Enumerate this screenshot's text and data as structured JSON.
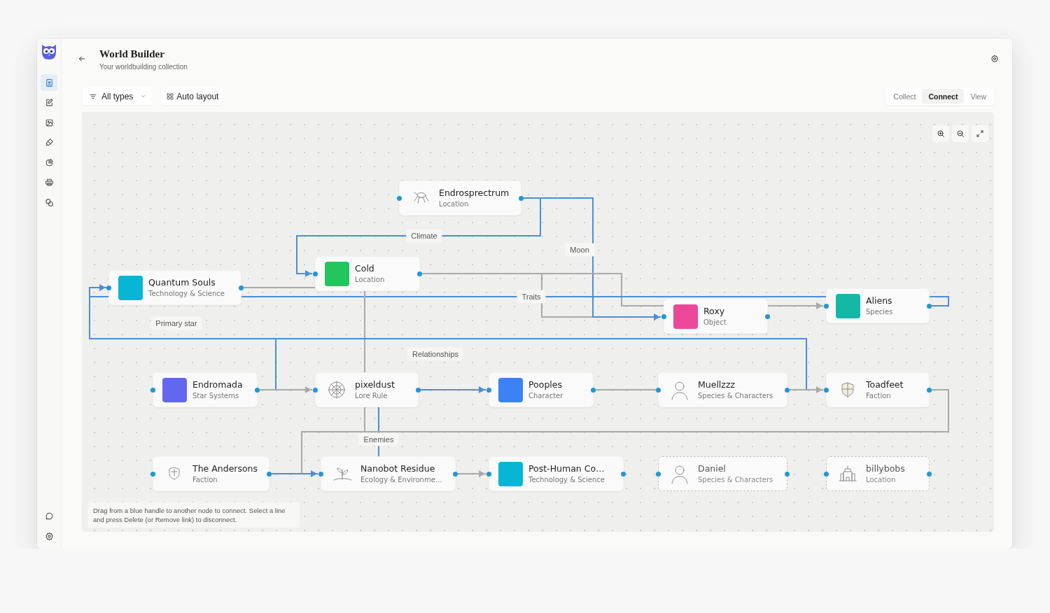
{
  "sidebar": {
    "items": [
      {
        "selected": true
      },
      {
        "selected": false
      },
      {
        "selected": false
      },
      {
        "selected": false
      },
      {
        "selected": false
      },
      {
        "selected": false
      },
      {
        "selected": false
      }
    ]
  },
  "header": {
    "title": "World Builder",
    "subtitle": "Your worldbuilding collection"
  },
  "toolbar": {
    "filter": "All types",
    "layout_button": "Auto layout"
  },
  "modes": [
    {
      "label": "Collect",
      "selected": false
    },
    {
      "label": "Connect",
      "selected": true
    },
    {
      "label": "View",
      "selected": false
    }
  ],
  "canvas": {
    "nodes": [
      {
        "title": "Endrosprectrum",
        "type": "Location",
        "kind": "image",
        "unlinked": false
      },
      {
        "title": "Cold",
        "type": "Location",
        "kind": "swatch",
        "color": "#22c55e",
        "unlinked": false
      },
      {
        "title": "Quantum Souls",
        "type": "Technology & Science",
        "kind": "swatch",
        "color": "#06b6d4",
        "unlinked": false
      },
      {
        "title": "Aliens",
        "type": "Species",
        "kind": "swatch",
        "color": "#14b8a6",
        "unlinked": false
      },
      {
        "title": "Roxy",
        "type": "Object",
        "kind": "swatch",
        "color": "#ec4899",
        "unlinked": false
      },
      {
        "title": "Endromada",
        "type": "Star Systems",
        "kind": "swatch",
        "color": "#6366f1",
        "unlinked": false
      },
      {
        "title": "pixeldust",
        "type": "Lore Rule",
        "kind": "image",
        "unlinked": false
      },
      {
        "title": "Pooples",
        "type": "Character",
        "kind": "swatch",
        "color": "#3b82f6",
        "unlinked": false
      },
      {
        "title": "Muellzzz",
        "type": "Species & Characters",
        "kind": "image",
        "unlinked": false
      },
      {
        "title": "Toadfeet",
        "type": "Faction",
        "kind": "image",
        "unlinked": false
      },
      {
        "title": "The Andersons",
        "type": "Faction",
        "kind": "image",
        "unlinked": false
      },
      {
        "title": "Nanobot Residue",
        "type": "Ecology & Environme…",
        "kind": "image",
        "unlinked": false
      },
      {
        "title": "Post-Human Co…",
        "type": "Technology & Science",
        "kind": "swatch",
        "color": "#06b6d4",
        "unlinked": false
      },
      {
        "title": "Daniel",
        "type": "Species & Characters",
        "kind": "image",
        "unlinked": true
      },
      {
        "title": "billybobs",
        "type": "Location",
        "kind": "image",
        "unlinked": true
      }
    ],
    "connections": [
      {
        "label": "Climate",
        "color": "#4a8fd6",
        "arrow": true
      },
      {
        "label": "Moon",
        "color": "#4a8fd6",
        "arrow": true
      },
      {
        "color": "#a9a9a9",
        "arrow": false
      },
      {
        "color": "#a9a9a9",
        "arrow": true
      },
      {
        "label": "Traits",
        "color": "#4a8fd6",
        "arrow": false
      },
      {
        "color": "#a9a9a9",
        "arrow": false
      },
      {
        "label": "Primary star",
        "color": "#4a8fd6",
        "arrow": true
      },
      {
        "label": "Relationships",
        "color": "#a9a9a9",
        "arrow": false
      },
      {
        "color": "#4a8fd6",
        "arrow": false
      },
      {
        "color": "#a9a9a9",
        "arrow": true
      },
      {
        "color": "#4a8fd6",
        "arrow": true
      },
      {
        "color": "#a9a9a9",
        "arrow": false
      },
      {
        "color": "#a9a9a9",
        "arrow": true
      },
      {
        "label": "Enemies",
        "color": "#4a8fd6",
        "arrow": false
      },
      {
        "color": "#a9a9a9",
        "arrow": false
      },
      {
        "color": "#4a8fd6",
        "arrow": true
      },
      {
        "color": "#a9a9a9",
        "arrow": true
      },
      {
        "color": "#a9a9a9",
        "arrow": false
      }
    ],
    "hint": "Drag from a blue handle to another node to connect. Select a line and press Delete (or Remove link) to disconnect."
  }
}
